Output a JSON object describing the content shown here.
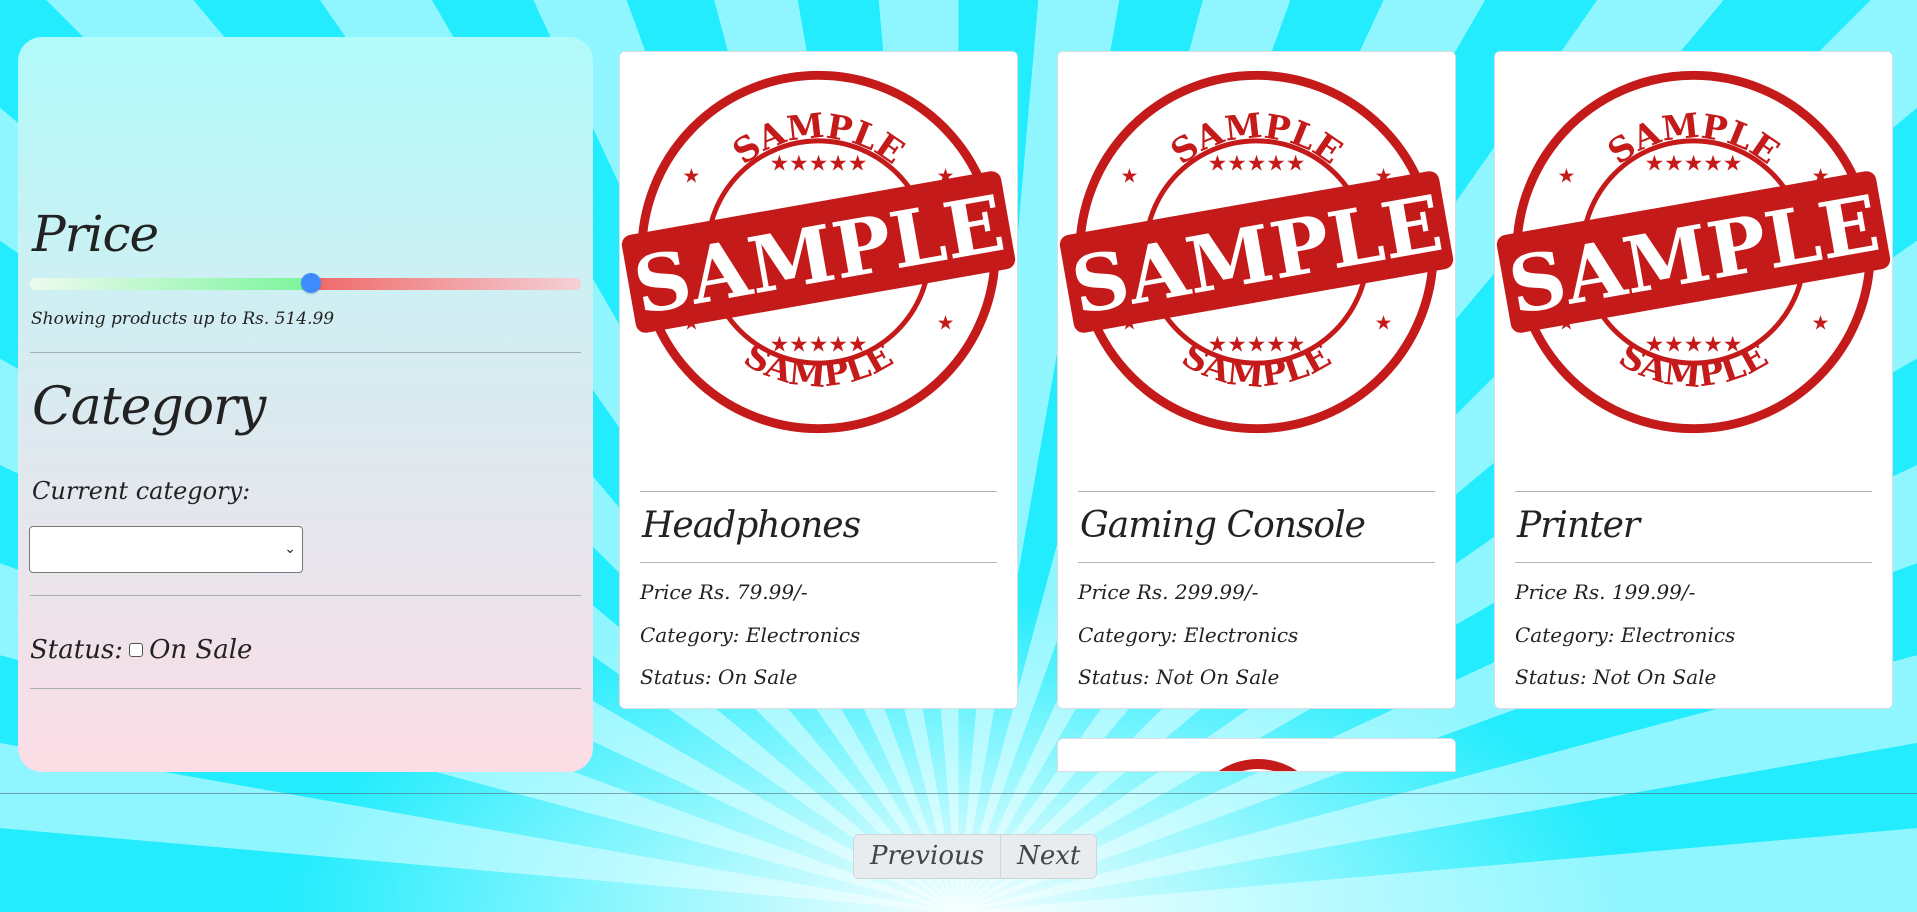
{
  "filters": {
    "price": {
      "title": "Price",
      "slider_level": 0.51,
      "caption": "Showing products up to Rs. 514.99"
    },
    "category": {
      "title": "Category",
      "current_label": "Current category:",
      "selected": ""
    },
    "status": {
      "label": "Status:",
      "option_label": "On Sale",
      "checked": false
    }
  },
  "stamp": {
    "top_text": "SAMPLE",
    "banner_text": "SAMPLE",
    "bottom_text": "SAMPLE",
    "color": "#c41a1a"
  },
  "products": [
    {
      "name": "Headphones",
      "price": "Price Rs. 79.99/-",
      "category": "Category: Electronics",
      "status": "Status: On Sale"
    },
    {
      "name": "Gaming Console",
      "price": "Price Rs. 299.99/-",
      "category": "Category: Electronics",
      "status": "Status: Not On Sale"
    },
    {
      "name": "Printer",
      "price": "Price Rs. 199.99/-",
      "category": "Category: Electronics",
      "status": "Status: Not On Sale"
    }
  ],
  "pagination": {
    "previous_label": "Previous",
    "next_label": "Next"
  }
}
